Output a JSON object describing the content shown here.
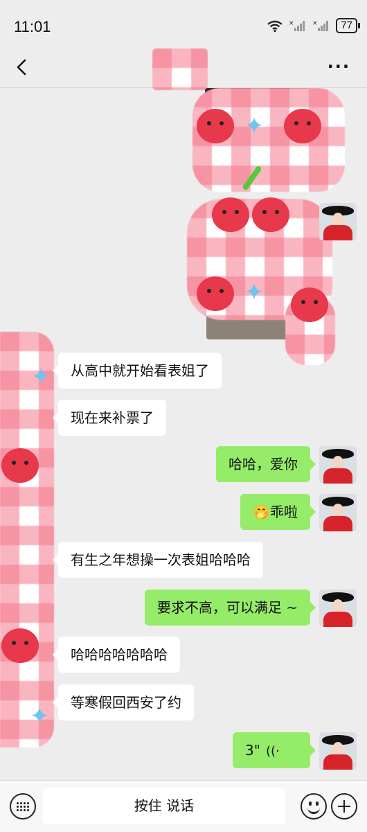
{
  "status": {
    "time": "11:01",
    "battery": "77"
  },
  "nav": {
    "back_icon": "back-chevron-icon",
    "more_label": "···"
  },
  "messages": [
    {
      "side": "in",
      "text": "从高中就开始看表姐了"
    },
    {
      "side": "in",
      "text": "现在来补票了"
    },
    {
      "side": "out",
      "text": "哈哈，爱你"
    },
    {
      "side": "out",
      "emoji": "🤭",
      "text": "乖啦"
    },
    {
      "side": "in",
      "text": "有生之年想操一次表姐哈哈哈"
    },
    {
      "side": "out",
      "text": "要求不高，可以满足 ~"
    },
    {
      "side": "in",
      "text": "哈哈哈哈哈哈哈"
    },
    {
      "side": "in",
      "text": "等寒假回西安了约"
    },
    {
      "side": "out",
      "voice_duration": "3\""
    }
  ],
  "input": {
    "hold_to_talk": "按住 说话"
  },
  "colors": {
    "outgoing_bubble": "#95ec69",
    "incoming_bubble": "#ffffff",
    "background": "#ededed"
  }
}
